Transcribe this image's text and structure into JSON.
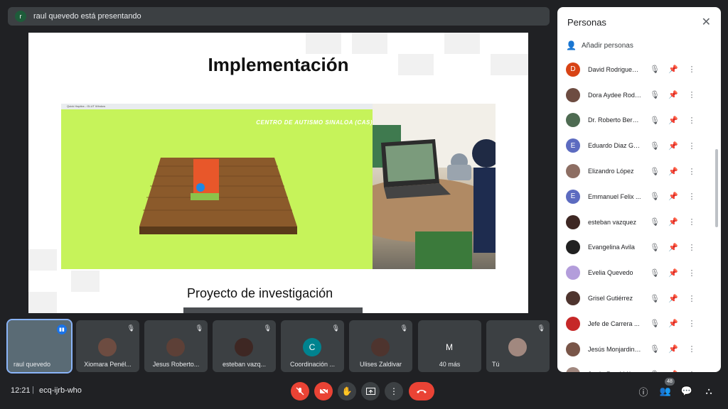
{
  "banner": {
    "avatar_letter": "r",
    "text": "raul quevedo está presentando"
  },
  "slide": {
    "title": "Implementación",
    "game_titlebar": "Quick Haptics - GLUT Window",
    "game_banner": "CENTRO DE AUTISMO SINALOA (CAS)",
    "subtitle": "Proyecto de investigación"
  },
  "panel": {
    "title": "Personas",
    "close_icon": "close-icon",
    "add_people": "Añadir personas",
    "people": [
      {
        "name": "David Rodriguez ...",
        "initial": "D",
        "color": "#d84315"
      },
      {
        "name": "Dora Aydee Rodr...",
        "initial": "",
        "color": "#6d4c41"
      },
      {
        "name": "Dr. Roberto Bern...",
        "initial": "",
        "color": "#4e6b52"
      },
      {
        "name": "Eduardo Diaz Ga...",
        "initial": "E",
        "color": "#5c6bc0"
      },
      {
        "name": "Elizandro López",
        "initial": "",
        "color": "#8d6e63"
      },
      {
        "name": "Emmanuel Felix ...",
        "initial": "E",
        "color": "#5c6bc0"
      },
      {
        "name": "esteban vazquez",
        "initial": "",
        "color": "#3e2723"
      },
      {
        "name": "Evangelina Avila",
        "initial": "",
        "color": "#212121"
      },
      {
        "name": "Evelia Quevedo",
        "initial": "",
        "color": "#b39ddb"
      },
      {
        "name": "Grisel Gutiérrez",
        "initial": "",
        "color": "#4e342e"
      },
      {
        "name": "Jefe de Carrera ...",
        "initial": "",
        "color": "#c62828"
      },
      {
        "name": "Jesús Monjardin ...",
        "initial": "",
        "color": "#795548"
      },
      {
        "name": "Jesús René Vázq...",
        "initial": "",
        "color": "#a1887f"
      }
    ]
  },
  "tiles": [
    {
      "name": "raul quevedo",
      "avatar": ""
    },
    {
      "name": "Xiomara Penél...",
      "avatar": ""
    },
    {
      "name": "Jesus Roberto...",
      "avatar": ""
    },
    {
      "name": "esteban vazq...",
      "avatar": ""
    },
    {
      "name": "Coordinación ...",
      "avatar": "C"
    },
    {
      "name": "Ulises Zaldivar",
      "avatar": ""
    },
    {
      "name": "40 más",
      "avatar": "M"
    },
    {
      "name": "Tú",
      "avatar": ""
    }
  ],
  "bottom": {
    "time": "12:21",
    "separator": "|",
    "meeting_code": "ecq-ijrb-who",
    "participants_count": "48"
  }
}
